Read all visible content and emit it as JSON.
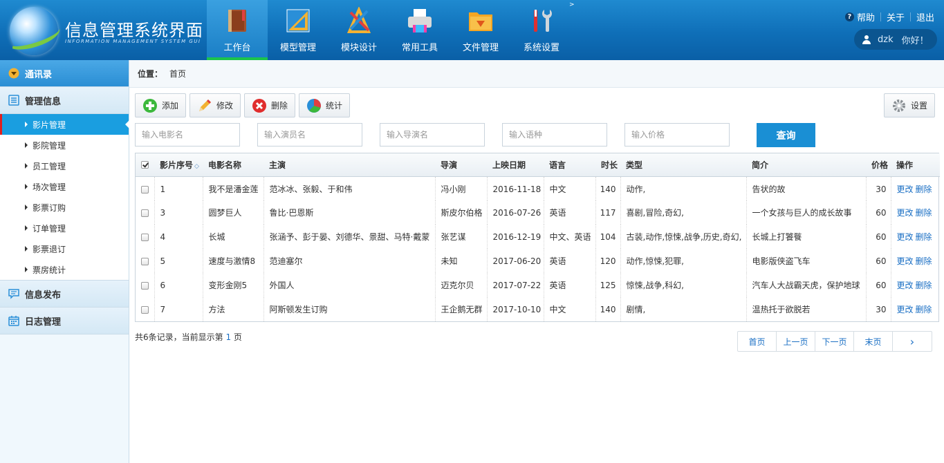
{
  "header": {
    "app_title": "信息管理系统界面",
    "app_subtitle": "INFORMATION MANAGEMENT SYSTEM GUI",
    "nav": [
      {
        "label": "工作台",
        "icon": "book-icon",
        "active": true
      },
      {
        "label": "模型管理",
        "icon": "ruler-triangle-icon",
        "active": false
      },
      {
        "label": "模块设计",
        "icon": "design-tools-icon",
        "active": false
      },
      {
        "label": "常用工具",
        "icon": "printer-icon",
        "active": false
      },
      {
        "label": "文件管理",
        "icon": "folder-icon",
        "active": false
      },
      {
        "label": "系统设置",
        "icon": "tools-icon",
        "active": false
      }
    ],
    "top_links": {
      "help": "帮助",
      "about": "关于",
      "logout": "退出"
    },
    "user": {
      "name": "dzk",
      "greeting": "你好！"
    },
    "caret": ">"
  },
  "sidebar": {
    "contacts": "通讯录",
    "manage_info": "管理信息",
    "items": [
      {
        "label": "影片管理",
        "active": true
      },
      {
        "label": "影院管理",
        "active": false
      },
      {
        "label": "员工管理",
        "active": false
      },
      {
        "label": "场次管理",
        "active": false
      },
      {
        "label": "影票订购",
        "active": false
      },
      {
        "label": "订单管理",
        "active": false
      },
      {
        "label": "影票退订",
        "active": false
      },
      {
        "label": "票房统计",
        "active": false
      }
    ],
    "publish": "信息发布",
    "log": "日志管理"
  },
  "breadcrumb": {
    "label": "位置：",
    "current": "首页"
  },
  "toolbar": {
    "add": "添加",
    "edit": "修改",
    "delete": "删除",
    "stats": "统计",
    "settings": "设置"
  },
  "search": {
    "movie_placeholder": "输入电影名",
    "actor_placeholder": "输入演员名",
    "director_placeholder": "输入导演名",
    "language_placeholder": "输入语种",
    "price_placeholder": "输入价格",
    "button": "查询"
  },
  "table": {
    "headers": [
      "影片序号",
      "电影名称",
      "主演",
      "导演",
      "上映日期",
      "语言",
      "时长",
      "类型",
      "简介",
      "价格",
      "操作"
    ],
    "rows": [
      {
        "id": "1",
        "name": "我不是潘金莲",
        "cast": "范冰冰、张毅、于和伟",
        "director": "冯小刚",
        "date": "2016-11-18",
        "lang": "中文",
        "duration": "140",
        "genre": "动作,",
        "intro": "告状的故",
        "price": "30"
      },
      {
        "id": "3",
        "name": "圆梦巨人",
        "cast": "鲁比·巴恩斯",
        "director": "斯皮尔伯格",
        "date": "2016-07-26",
        "lang": "英语",
        "duration": "117",
        "genre": "喜剧,冒险,奇幻,",
        "intro": "一个女孩与巨人的成长故事",
        "price": "60"
      },
      {
        "id": "4",
        "name": "长城",
        "cast": "张涵予、彭于晏、刘德华、景甜、马特·戴蒙",
        "director": "张艺谋",
        "date": "2016-12-19",
        "lang": "中文、英语",
        "duration": "104",
        "genre": "古装,动作,惊悚,战争,历史,奇幻,",
        "intro": "长城上打饕餮",
        "price": "60"
      },
      {
        "id": "5",
        "name": "速度与激情8",
        "cast": "范迪塞尔",
        "director": "未知",
        "date": "2017-06-20",
        "lang": "英语",
        "duration": "120",
        "genre": "动作,惊悚,犯罪,",
        "intro": "电影版侠盗飞车",
        "price": "60"
      },
      {
        "id": "6",
        "name": "变形金刚5",
        "cast": "外国人",
        "director": "迈克尔贝",
        "date": "2017-07-22",
        "lang": "英语",
        "duration": "125",
        "genre": "惊悚,战争,科幻,",
        "intro": "汽车人大战霸天虎，保护地球",
        "price": "60"
      },
      {
        "id": "7",
        "name": "方法",
        "cast": "阿斯顿发生订购",
        "director": "王企鹅无群",
        "date": "2017-10-10",
        "lang": "中文",
        "duration": "140",
        "genre": "剧情,",
        "intro": "温热托于欲脱若",
        "price": "30"
      }
    ],
    "op_edit": "更改",
    "op_delete": "删除"
  },
  "footer": {
    "prefix": "共6条记录，当前显示第 ",
    "page": "1",
    "suffix": " 页"
  },
  "pager": {
    "first": "首页",
    "prev": "上一页",
    "next": "下一页",
    "last": "末页",
    "arrow": "›"
  }
}
